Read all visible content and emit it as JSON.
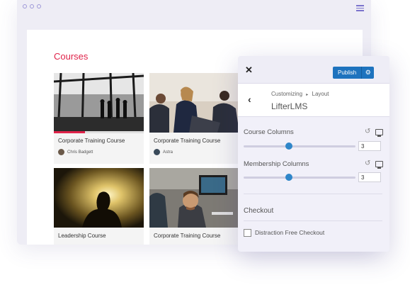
{
  "page": {
    "heading": "Courses",
    "courses": [
      {
        "title": "Corporate Training Course",
        "author": "Chris Badgett"
      },
      {
        "title": "Corporate Training Course",
        "author": "Astra"
      },
      {
        "title": "Leadership Course",
        "author": ""
      },
      {
        "title": "Corporate Training Course",
        "author": ""
      }
    ],
    "progress": 0.35
  },
  "customizer": {
    "publish_label": "Publish",
    "breadcrumb_root": "Customizing",
    "breadcrumb_sep": "▸",
    "breadcrumb_leaf": "Layout",
    "panel_title": "LifterLMS",
    "course_columns": {
      "label": "Course Columns",
      "value": "3"
    },
    "membership_columns": {
      "label": "Membership Columns",
      "value": "3"
    },
    "checkout_heading": "Checkout",
    "distraction_free_label": "Distraction Free Checkout"
  },
  "colors": {
    "accent": "#e0234a",
    "publish": "#1e73be",
    "slider": "#2f86c9"
  }
}
